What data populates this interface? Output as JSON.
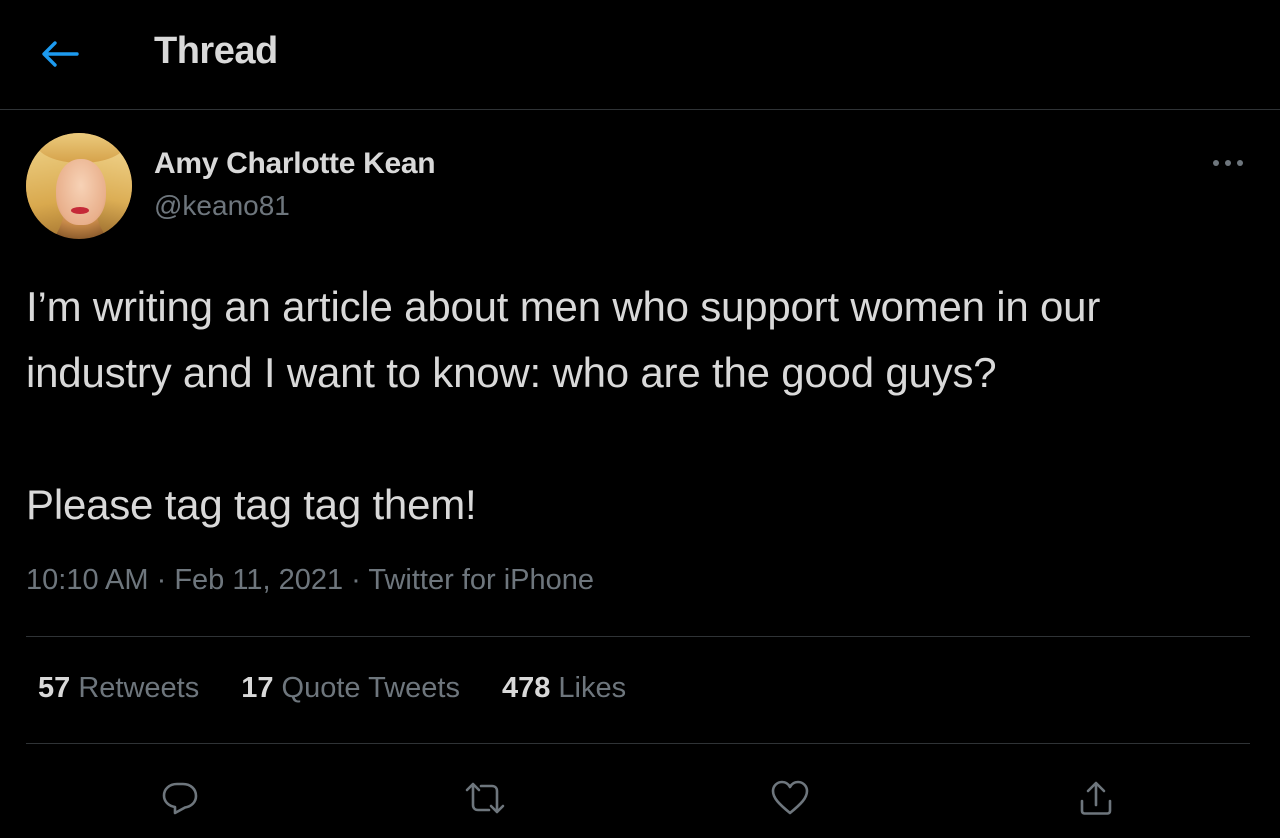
{
  "header": {
    "title": "Thread",
    "back_icon": "arrow-left-icon",
    "accent": "#1d9bf0"
  },
  "tweet": {
    "author_name": "Amy Charlotte Kean",
    "author_handle": "@keano81",
    "text": "I’m writing an article about men who support women in our industry and I want to know: who are the good guys?\n\nPlease tag tag tag them!",
    "time": "10:10 AM",
    "date": "Feb 11, 2021",
    "source": "Twitter for iPhone",
    "separator": "·"
  },
  "stats": {
    "retweets_count": "57",
    "retweets_label": "Retweets",
    "quotes_count": "17",
    "quotes_label": "Quote Tweets",
    "likes_count": "478",
    "likes_label": "Likes"
  },
  "actions": {
    "icons": [
      "reply-icon",
      "retweet-icon",
      "like-icon",
      "share-icon"
    ]
  },
  "colors": {
    "background": "#000000",
    "text": "#d9d9d9",
    "muted": "#6e767d",
    "border": "#2f3336"
  }
}
